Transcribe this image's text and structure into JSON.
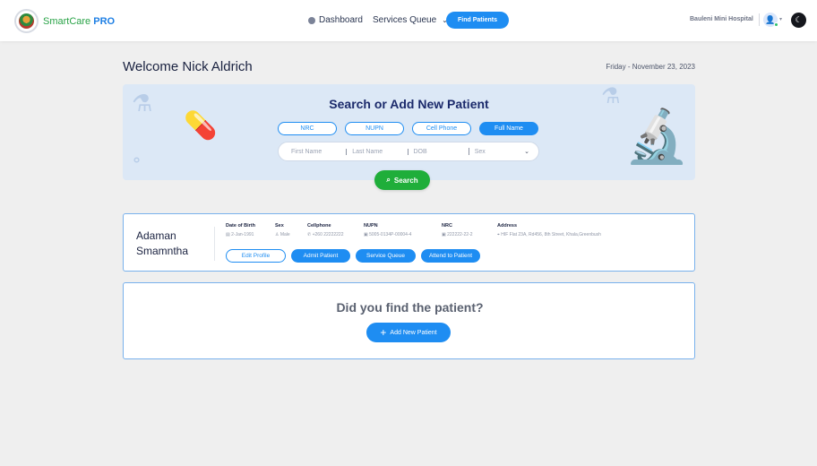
{
  "header": {
    "brand_main": "SmartCare",
    "brand_suffix": "PRO",
    "nav_dashboard": "Dashboard",
    "nav_services_queue": "Services Queue",
    "find_patients": "Find Patients",
    "hospital": "Bauleni Mini Hospital"
  },
  "welcome": "Welcome Nick Aldrich",
  "date": "Friday - November 23, 2023",
  "search": {
    "title": "Search or Add New Patient",
    "tabs": [
      "NRC",
      "NUPN",
      "Cell Phone",
      "Full Name"
    ],
    "active_tab": "Full Name",
    "placeholders": {
      "first_name": "First Name",
      "last_name": "Last Name",
      "dob": "DOB",
      "sex": "Sex"
    },
    "button": "Search"
  },
  "patient": {
    "first_name": "Adaman",
    "last_name": "Smamntha",
    "fields": [
      {
        "label": "Date of Birth",
        "value": "2-Jan-1991"
      },
      {
        "label": "Sex",
        "value": "Male"
      },
      {
        "label": "Cellphone",
        "value": "+260 22222222"
      },
      {
        "label": "NUPN",
        "value": "5005-0134P-00004-4"
      },
      {
        "label": "NRC",
        "value": "222222-22-2"
      },
      {
        "label": "Address",
        "value": "HIF Flat 23A, Rd456, 8th Street, Khala,Greenbush"
      }
    ],
    "actions": {
      "edit": "Edit Profile",
      "admit": "Admit Patient",
      "queue": "Service Queue",
      "attend": "Attend to Patient"
    }
  },
  "found": {
    "question": "Did you find the patient?",
    "add_button": "Add New Patient"
  }
}
